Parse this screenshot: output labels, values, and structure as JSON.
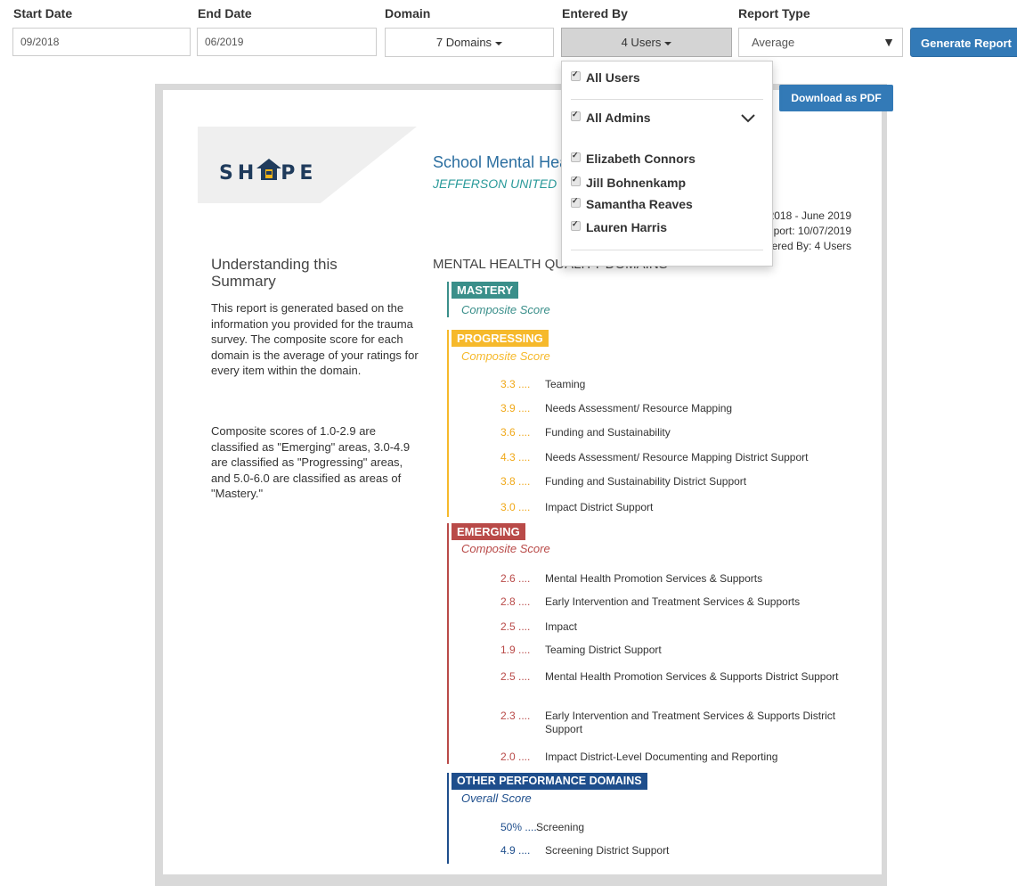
{
  "filters": {
    "start_date": {
      "label": "Start Date",
      "value": "09/2018"
    },
    "end_date": {
      "label": "End Date",
      "value": "06/2019"
    },
    "domain": {
      "label": "Domain",
      "value": "7 Domains"
    },
    "entered_by": {
      "label": "Entered By",
      "value": "4 Users"
    },
    "report_type": {
      "label": "Report Type",
      "value": "Average"
    },
    "generate_label": "Generate Report"
  },
  "dropdown": {
    "all_users": "All Users",
    "all_admins": "All Admins",
    "users": [
      "Elizabeth Connors",
      "Jill Bohnenkamp",
      "Samantha Reaves",
      "Lauren Harris"
    ]
  },
  "report": {
    "download_label": "Download as PDF",
    "logo": "SHAPE",
    "title": "School Mental Health Quality Report",
    "subtitle": "JEFFERSON UNITED",
    "meta_lines": [
      "September 2018 - June 2019",
      "Date of Report: 10/07/2019",
      "Entered By: 4 Users"
    ],
    "understanding_title": "Understanding this Summary",
    "understanding_p1": "This report is generated based on the information you provided for the trauma survey. The composite score for each domain is the average of your ratings for every item within the domain.",
    "understanding_p2": "Composite scores of 1.0-2.9 are classified as \"Emerging\" areas, 3.0-4.9 are classified as \"Progressing\" areas, and 5.0-6.0 are classified as areas of \"Mastery.\"",
    "domains_title": "MENTAL HEALTH QUALITY DOMAINS",
    "sections": {
      "mastery": {
        "label": "MASTERY",
        "sub": "Composite Score",
        "color": "#3a8f8a"
      },
      "progressing": {
        "label": "PROGRESSING",
        "sub": "Composite Score",
        "color": "#f6b92b",
        "items": [
          {
            "score": "3.3 ....",
            "name": "Teaming"
          },
          {
            "score": "3.9 ....",
            "name": "Needs Assessment/ Resource Mapping"
          },
          {
            "score": "3.6 ....",
            "name": "Funding and Sustainability"
          },
          {
            "score": "4.3 ....",
            "name": "Needs Assessment/ Resource Mapping District Support"
          },
          {
            "score": "3.8 ....",
            "name": "Funding and Sustainability District Support"
          },
          {
            "score": "3.0 ....",
            "name": "Impact District Support"
          }
        ]
      },
      "emerging": {
        "label": "EMERGING",
        "sub": "Composite Score",
        "color": "#b94a48",
        "items": [
          {
            "score": "2.6 ....",
            "name": "Mental Health Promotion Services & Supports"
          },
          {
            "score": "2.8 ....",
            "name": "Early Intervention and Treatment Services & Supports"
          },
          {
            "score": "2.5 ....",
            "name": "Impact"
          },
          {
            "score": "1.9 ....",
            "name": "Teaming District Support"
          },
          {
            "score": "2.5 ....",
            "name": "Mental Health Promotion Services & Supports District Support"
          },
          {
            "score": "2.3 ....",
            "name": "Early Intervention and Treatment Services & Supports District Support"
          },
          {
            "score": "2.0 ....",
            "name": "Impact District-Level Documenting and Reporting"
          }
        ]
      },
      "other": {
        "label": "OTHER PERFORMANCE DOMAINS",
        "sub": "Overall Score",
        "color": "#1e4e8c",
        "items": [
          {
            "score": "50% ....",
            "name": "Screening"
          },
          {
            "score": "4.9 ....",
            "name": "Screening District Support"
          }
        ]
      }
    }
  }
}
